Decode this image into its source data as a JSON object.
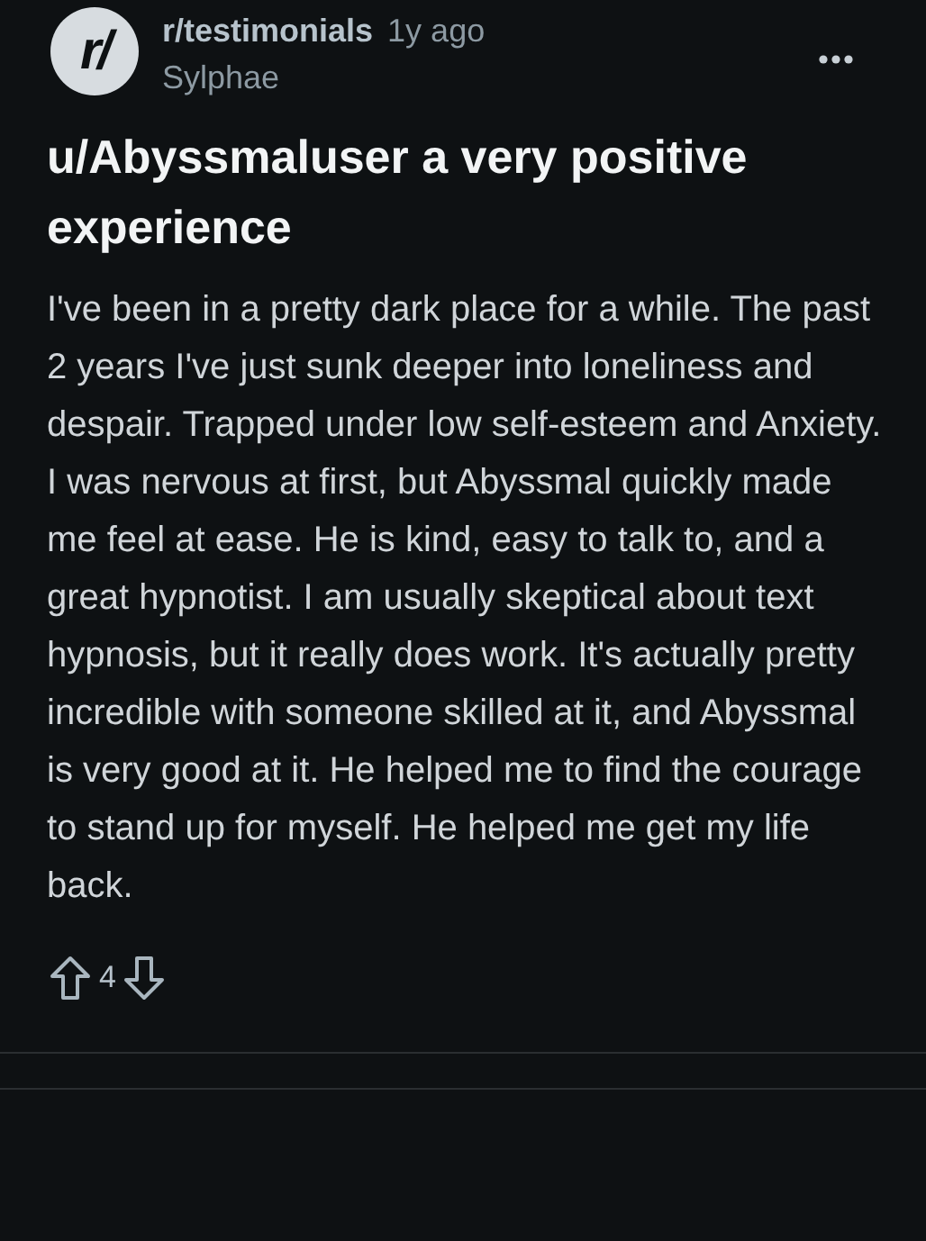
{
  "post": {
    "avatar_text": "r/",
    "subreddit": "r/testimonials",
    "time": "1y ago",
    "author": "Sylphae",
    "title": "u/Abyssmaluser a very positive experience",
    "paragraphs": [
      "I've been in a pretty dark place for a while. The past 2 years I've just sunk deeper into loneliness and despair. Trapped under low self-esteem and Anxiety.",
      "I was nervous at first, but Abyssmal quickly made me feel at ease. He is kind, easy to talk to, and a great hypnotist. I am usually skeptical about text hypnosis, but it really does work. It's actually pretty incredible with someone skilled at it, and Abyssmal is very good at it. He helped me to find the courage to stand up for myself. He helped me get my life back."
    ],
    "score": "4"
  }
}
